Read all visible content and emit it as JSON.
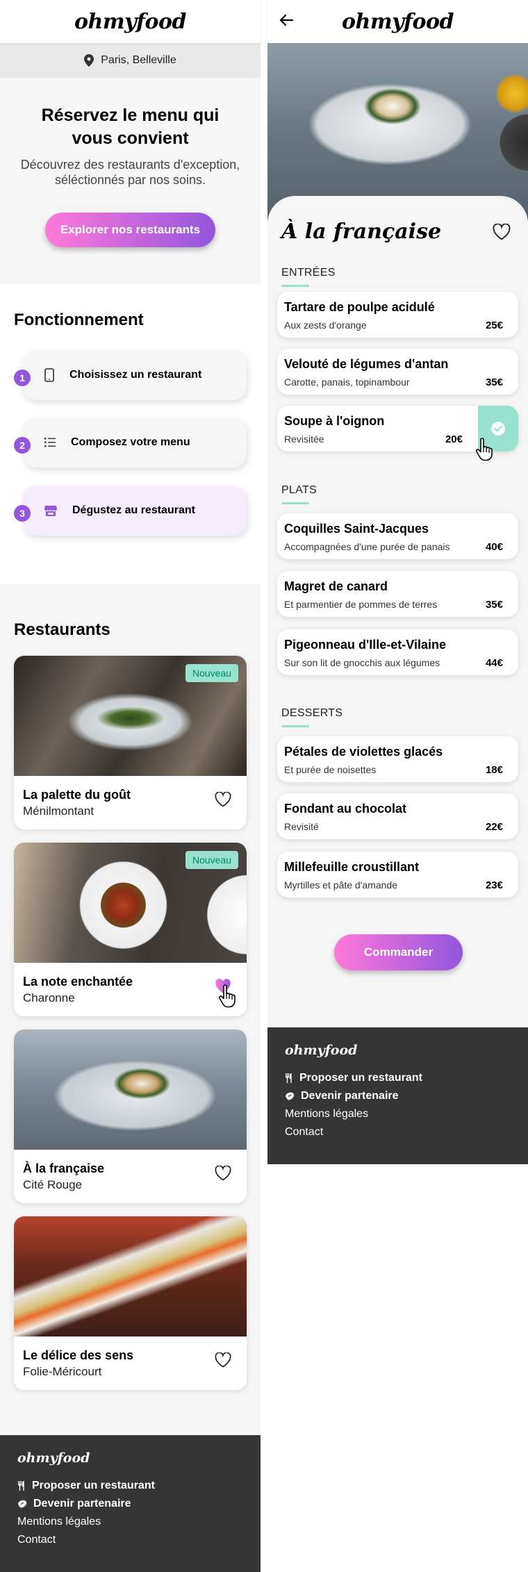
{
  "app": {
    "logo": "ohmyfood"
  },
  "home": {
    "location": "Paris, Belleville",
    "hero": {
      "title": "Réservez le menu qui vous convient",
      "subtitle": "Découvrez des restaurants d'exception, séléctionnés par nos soins.",
      "cta": "Explorer nos restaurants"
    },
    "how": {
      "title": "Fonctionnement",
      "steps": [
        {
          "num": "1",
          "label": "Choisissez un restaurant",
          "icon": "mobile-phone-icon"
        },
        {
          "num": "2",
          "label": "Composez votre menu",
          "icon": "list-icon"
        },
        {
          "num": "3",
          "label": "Dégustez au restaurant",
          "icon": "store-icon"
        }
      ]
    },
    "restaurants": {
      "title": "Restaurants",
      "items": [
        {
          "name": "La palette du goût",
          "area": "Ménilmontant",
          "badge": "Nouveau",
          "liked": false
        },
        {
          "name": "La note enchantée",
          "area": "Charonne",
          "badge": "Nouveau",
          "liked": true
        },
        {
          "name": "À la française",
          "area": "Cité Rouge",
          "badge": "",
          "liked": false
        },
        {
          "name": "Le délice des sens",
          "area": "Folie-Méricourt",
          "badge": "",
          "liked": false
        }
      ]
    }
  },
  "footer": {
    "logo": "ohmyfood",
    "links": [
      {
        "label": "Proposer un restaurant",
        "icon": "utensils-icon"
      },
      {
        "label": "Devenir partenaire",
        "icon": "handshake-icon"
      },
      {
        "label": "Mentions légales",
        "icon": ""
      },
      {
        "label": "Contact",
        "icon": ""
      }
    ]
  },
  "menu_page": {
    "restaurant": "À la française",
    "sections": [
      {
        "title": "ENTRÉES",
        "items": [
          {
            "name": "Tartare de poulpe acidulé",
            "desc": "Aux zests d'orange",
            "price": "25€",
            "selected": false
          },
          {
            "name": "Velouté de légumes d'antan",
            "desc": "Carotte, panais, topinambour",
            "price": "35€",
            "selected": false
          },
          {
            "name": "Soupe à l'oignon",
            "desc": "Revisitée",
            "price": "20€",
            "selected": true
          }
        ]
      },
      {
        "title": "PLATS",
        "items": [
          {
            "name": "Coquilles Saint-Jacques",
            "desc": "Accompagnées d'une purée de panais",
            "price": "40€",
            "selected": false
          },
          {
            "name": "Magret de canard",
            "desc": "Et parmentier de pommes de terres",
            "price": "35€",
            "selected": false
          },
          {
            "name": "Pigeonneau d'Ille-et-Vilaine",
            "desc": "Sur son lit de gnocchis aux légumes",
            "price": "44€",
            "selected": false
          }
        ]
      },
      {
        "title": "DESSERTS",
        "items": [
          {
            "name": "Pétales de violettes glacés",
            "desc": "Et purée de noisettes",
            "price": "18€",
            "selected": false
          },
          {
            "name": "Fondant au chocolat",
            "desc": "Revisité",
            "price": "22€",
            "selected": false
          },
          {
            "name": "Millefeuille croustillant",
            "desc": "Myrtilles et pâte d'amande",
            "price": "23€",
            "selected": false
          }
        ]
      }
    ],
    "cta": "Commander"
  },
  "colors": {
    "primary": "#9356dc",
    "secondary": "#ff79da",
    "tertiary": "#99e2d0",
    "footer": "#353535"
  }
}
